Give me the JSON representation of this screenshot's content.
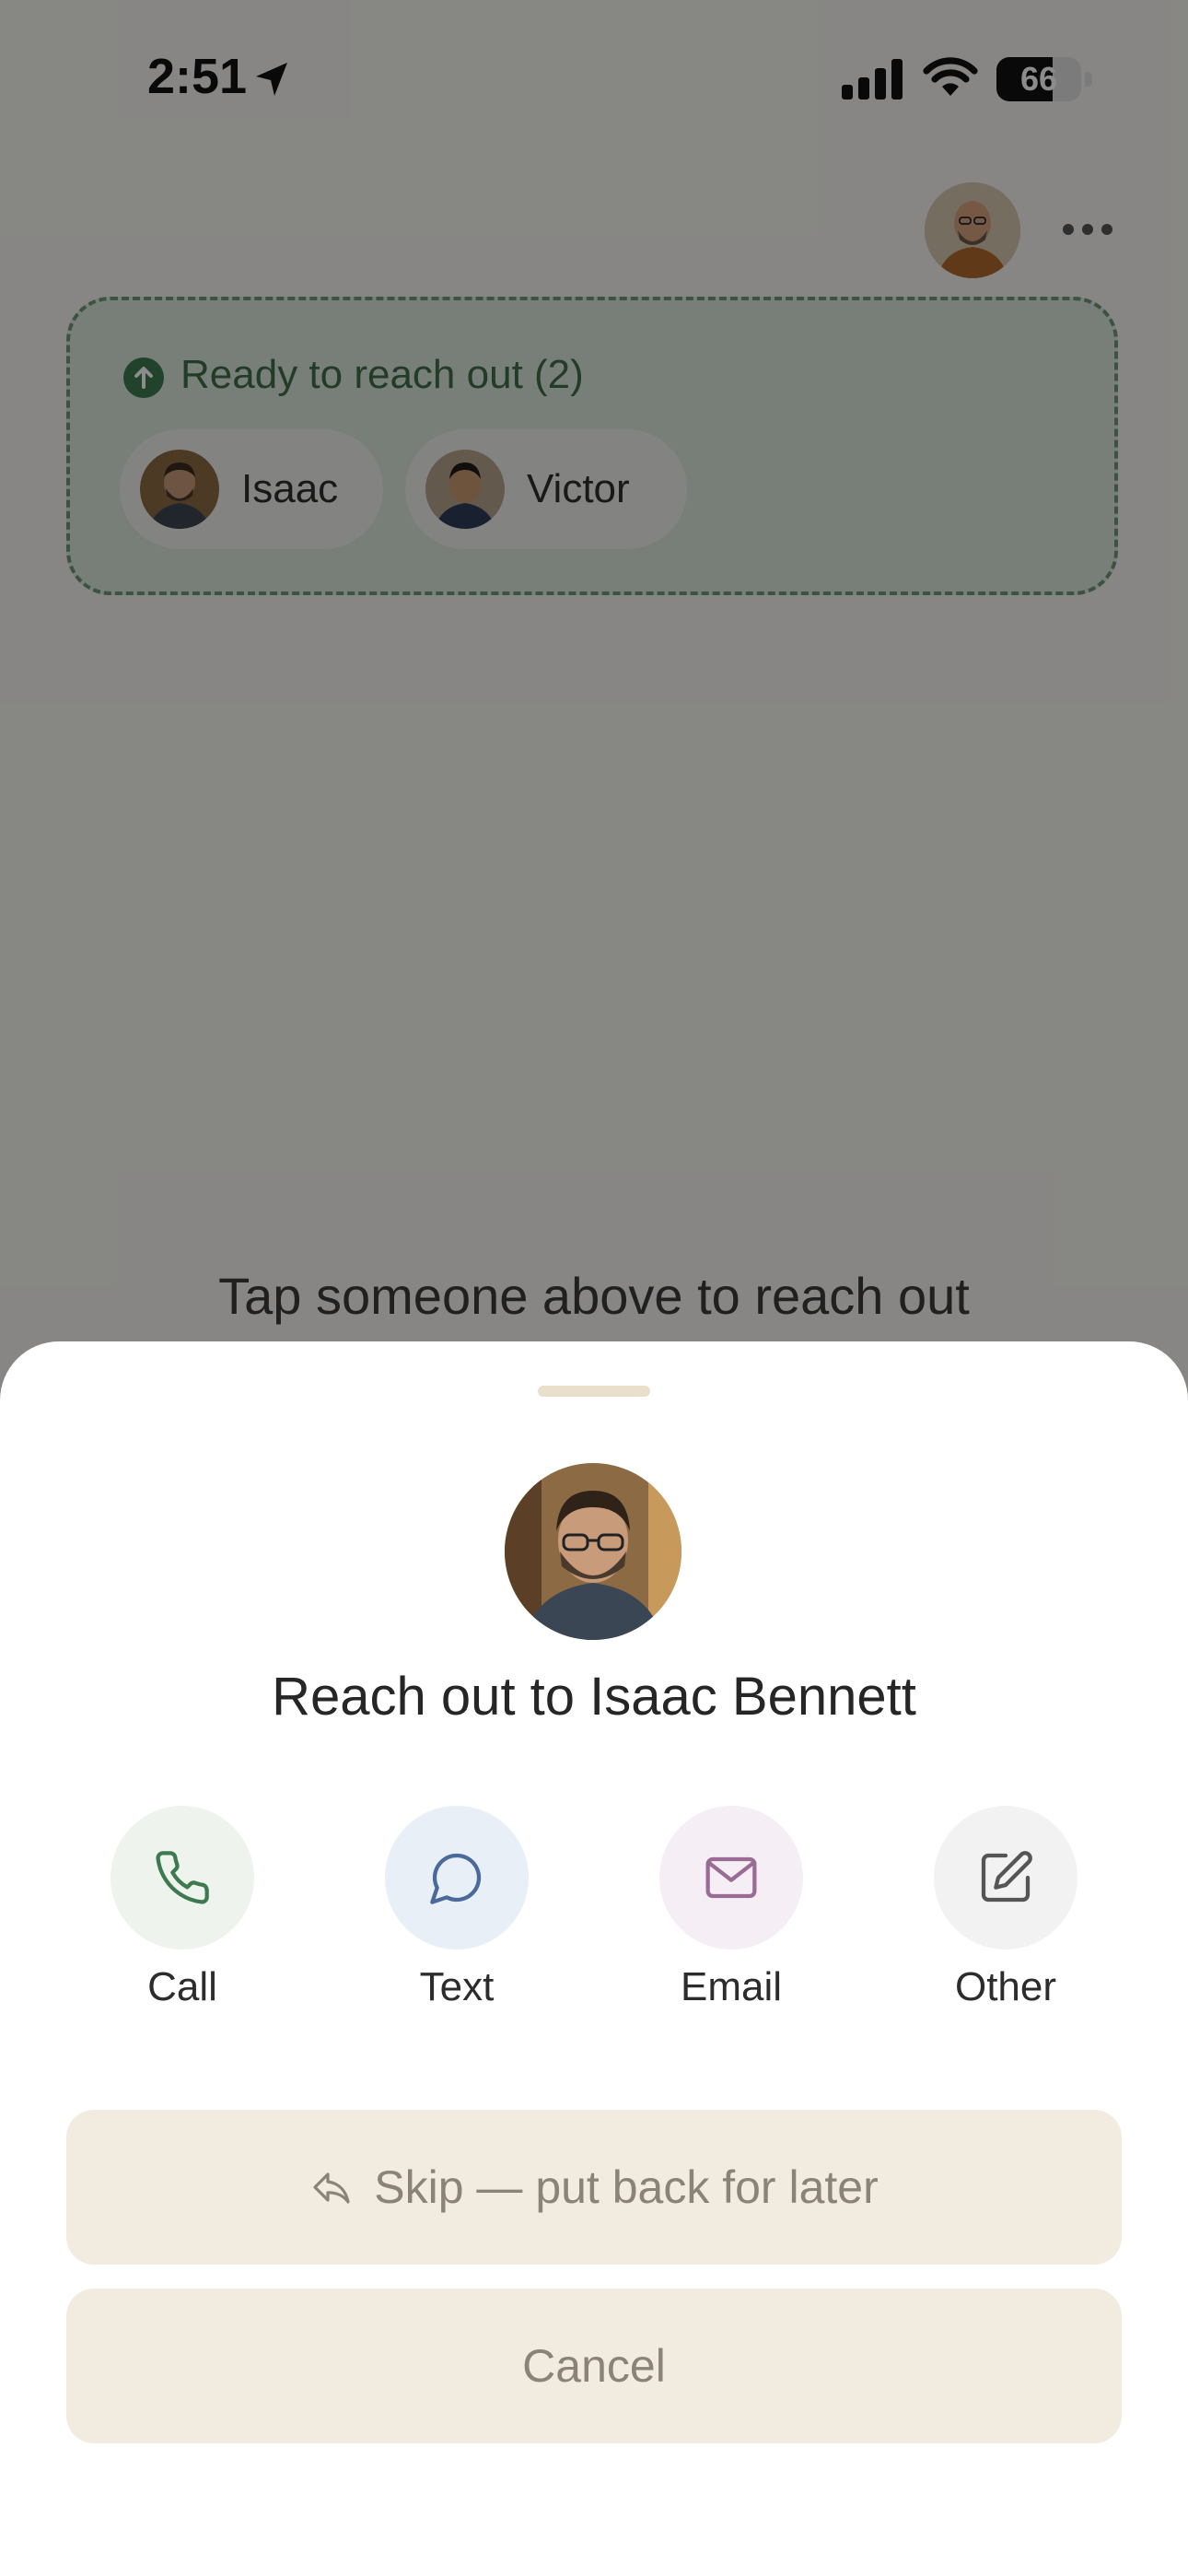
{
  "status_bar": {
    "time": "2:51",
    "battery": "66",
    "battery_level": 0.66
  },
  "ready": {
    "label": "Ready to reach out (2)",
    "people": [
      "Isaac",
      "Victor"
    ]
  },
  "hint": "Tap someone above to reach out",
  "sheet": {
    "title": "Reach out to Isaac Bennett",
    "actions": [
      "Call",
      "Text",
      "Email",
      "Other"
    ],
    "skip_label": "Skip — put back for later",
    "cancel_label": "Cancel"
  },
  "colors": {
    "accent_green": "#3e7a4f",
    "call_bg": "#eef3ee",
    "text_bg": "#e9eff6",
    "email_bg": "#f5eef5",
    "other_bg": "#f2f2f2",
    "button_bg": "#f2ebdf"
  },
  "icons": [
    "location-arrow-icon",
    "signal-icon",
    "wifi-icon",
    "more-icon",
    "arrow-up-icon",
    "phone-icon",
    "chat-bubble-icon",
    "mail-icon",
    "edit-icon",
    "reply-icon"
  ]
}
